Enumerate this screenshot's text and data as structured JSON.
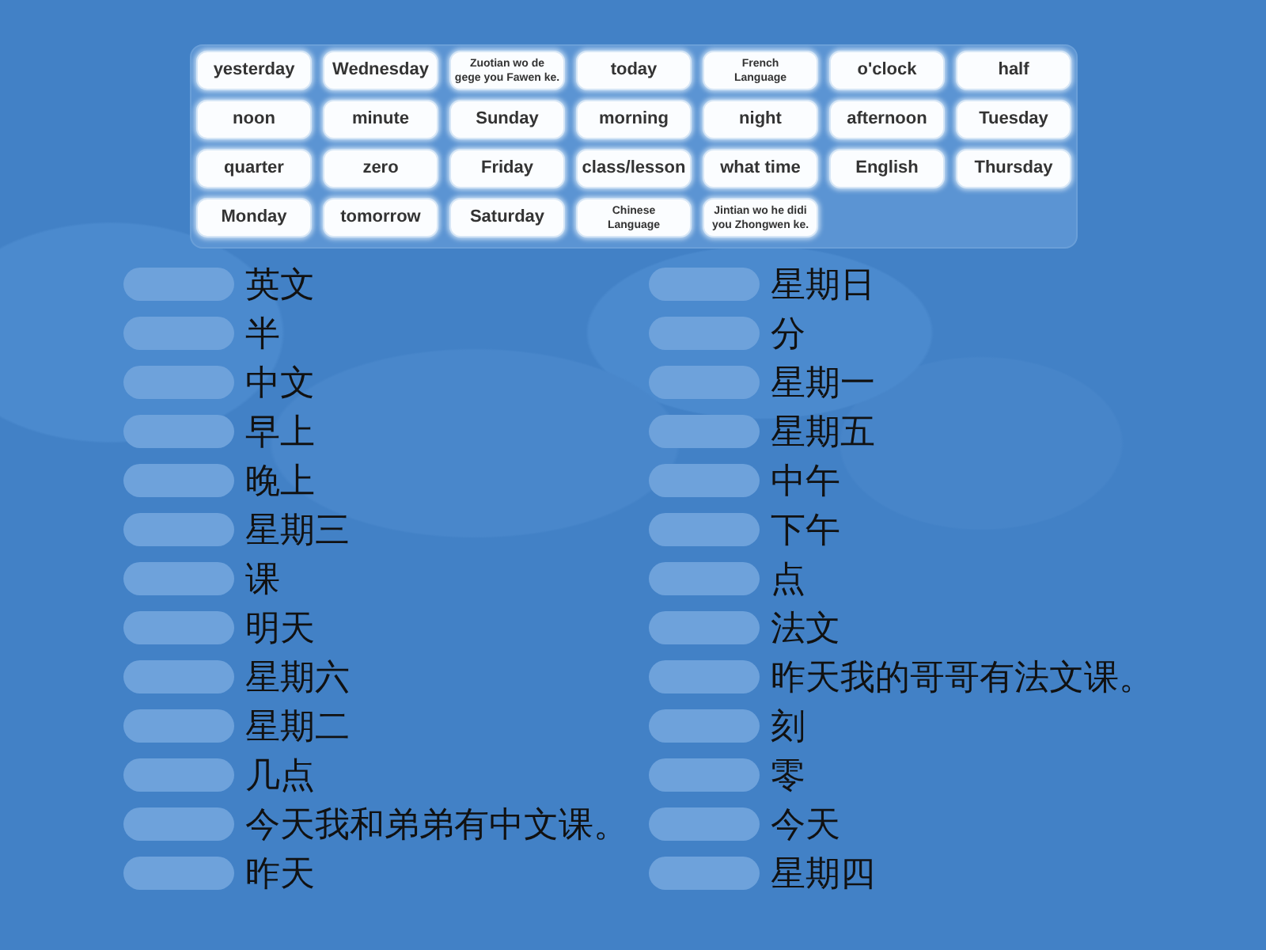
{
  "word_bank": {
    "tiles": [
      {
        "kind": "word",
        "text": "yesterday"
      },
      {
        "kind": "word",
        "text": "Wednesday"
      },
      {
        "kind": "phrase",
        "text": "Zuotian wo de\ngege you Fawen ke."
      },
      {
        "kind": "word",
        "text": "today"
      },
      {
        "kind": "phrase",
        "text": "French\nLanguage"
      },
      {
        "kind": "word",
        "text": "o'clock"
      },
      {
        "kind": "word",
        "text": "half"
      },
      {
        "kind": "word",
        "text": "noon"
      },
      {
        "kind": "word",
        "text": "minute"
      },
      {
        "kind": "word",
        "text": "Sunday"
      },
      {
        "kind": "word",
        "text": "morning"
      },
      {
        "kind": "word",
        "text": "night"
      },
      {
        "kind": "word",
        "text": "afternoon"
      },
      {
        "kind": "word",
        "text": "Tuesday"
      },
      {
        "kind": "word",
        "text": "quarter"
      },
      {
        "kind": "word",
        "text": "zero"
      },
      {
        "kind": "word",
        "text": "Friday"
      },
      {
        "kind": "word",
        "text": "class/lesson"
      },
      {
        "kind": "word",
        "text": "what time"
      },
      {
        "kind": "word",
        "text": "English"
      },
      {
        "kind": "word",
        "text": "Thursday"
      },
      {
        "kind": "word",
        "text": "Monday"
      },
      {
        "kind": "word",
        "text": "tomorrow"
      },
      {
        "kind": "word",
        "text": "Saturday"
      },
      {
        "kind": "phrase",
        "text": "Chinese\nLanguage"
      },
      {
        "kind": "phrase",
        "text": "Jintian wo he didi\nyou Zhongwen ke."
      }
    ]
  },
  "columns": [
    {
      "items": [
        {
          "prompt": "英文"
        },
        {
          "prompt": "半"
        },
        {
          "prompt": "中文"
        },
        {
          "prompt": "早上"
        },
        {
          "prompt": "晚上"
        },
        {
          "prompt": "星期三"
        },
        {
          "prompt": "课"
        },
        {
          "prompt": "明天"
        },
        {
          "prompt": "星期六"
        },
        {
          "prompt": "星期二"
        },
        {
          "prompt": "几点"
        },
        {
          "prompt": "今天我和弟弟有中文课。"
        },
        {
          "prompt": "昨天"
        }
      ]
    },
    {
      "items": [
        {
          "prompt": "星期日"
        },
        {
          "prompt": "分"
        },
        {
          "prompt": "星期一"
        },
        {
          "prompt": "星期五"
        },
        {
          "prompt": "中午"
        },
        {
          "prompt": "下午"
        },
        {
          "prompt": "点"
        },
        {
          "prompt": "法文"
        },
        {
          "prompt": "昨天我的哥哥有法文课。"
        },
        {
          "prompt": "刻"
        },
        {
          "prompt": "零"
        },
        {
          "prompt": "今天"
        },
        {
          "prompt": "星期四"
        }
      ]
    }
  ]
}
